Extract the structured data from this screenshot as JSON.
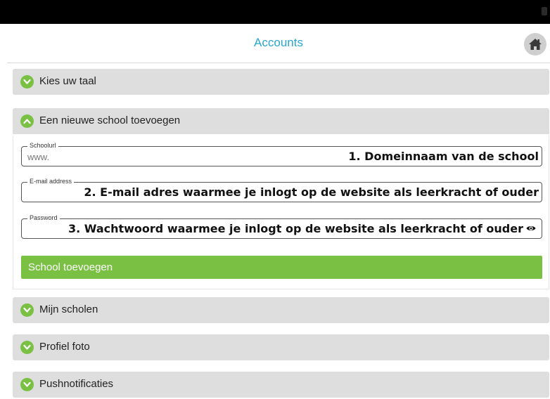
{
  "header": {
    "title": "Accounts",
    "home_icon": "home-icon"
  },
  "sections": {
    "language": "Kies uw taal",
    "add_school": "Een nieuwe school toevoegen",
    "my_schools": "Mijn scholen",
    "profile_photo": "Profiel foto",
    "push": "Pushnotificaties"
  },
  "form": {
    "schoolurl": {
      "legend": "Schoolurl",
      "value": "www.",
      "note": "1. Domeinnaam van de school"
    },
    "email": {
      "legend": "E-mail address",
      "note": "2. E-mail adres waarmee je inlogt op de website als leerkracht of ouder"
    },
    "password": {
      "legend": "Password",
      "note": "3. Wachtwoord waarmee je inlogt op de website als leerkracht of ouder",
      "icon": "eye-icon"
    },
    "submit_label": "School toevoegen"
  },
  "colors": {
    "accent_green": "#7ac143",
    "title_blue": "#2aa5cf",
    "section_bg": "#dedede"
  }
}
